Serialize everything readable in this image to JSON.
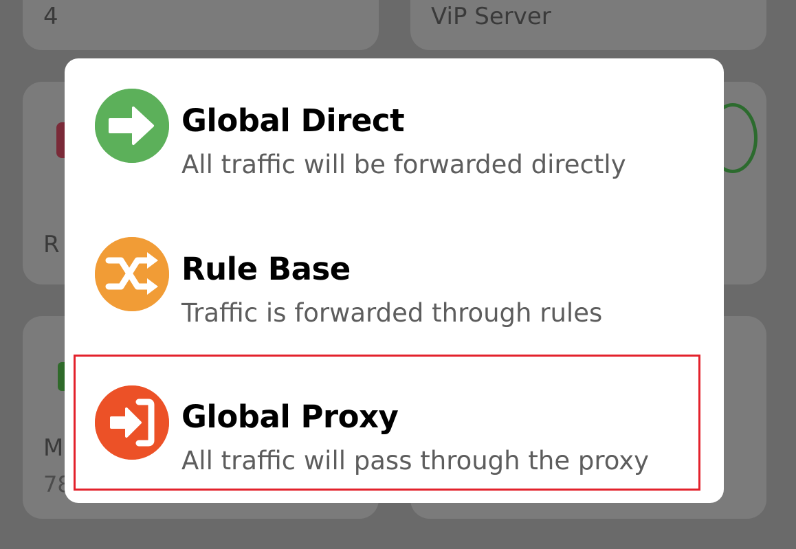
{
  "background": {
    "card_top_left_value": "4",
    "card_top_right_value": "ViP Server",
    "card_mid_left_label_fragment": "R",
    "card_bottom_left_label_fragment": "M",
    "card_bottom_left_sub_fragment": "78"
  },
  "menu": {
    "options": [
      {
        "title": "Global Direct",
        "description": "All traffic will be forwarded directly",
        "icon": "arrow-right-icon",
        "color": "#5cb05a"
      },
      {
        "title": "Rule Base",
        "description": "Traffic is forwarded through rules",
        "icon": "shuffle-icon",
        "color": "#f19c36"
      },
      {
        "title": "Global Proxy",
        "description": "All traffic will pass through the proxy",
        "icon": "login-icon",
        "color": "#ec5127"
      }
    ]
  },
  "highlight_color": "#e3222c"
}
